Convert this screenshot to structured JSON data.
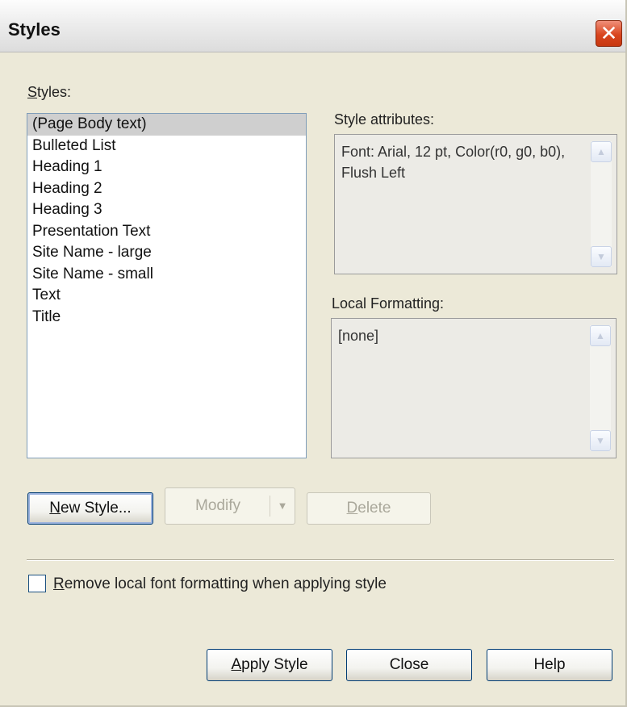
{
  "window": {
    "title": "Styles",
    "close_glyph": "✕"
  },
  "styles_list": {
    "label": "Styles:",
    "items": [
      "(Page Body text)",
      "Bulleted List",
      "Heading 1",
      "Heading 2",
      "Heading 3",
      "Presentation Text",
      "Site Name - large",
      "Site Name - small",
      "Text",
      "Title"
    ],
    "selected_index": 0
  },
  "style_attributes": {
    "label": "Style attributes:",
    "text": "Font: Arial, 12 pt, Color(r0, g0, b0), Flush Left"
  },
  "local_formatting": {
    "label": "Local Formatting:",
    "text": "[none]"
  },
  "buttons": {
    "new_style": "New Style...",
    "modify": "Modify",
    "delete": "Delete",
    "apply_style": "Apply Style",
    "close": "Close",
    "help": "Help"
  },
  "remove_formatting": {
    "label": "Remove local font formatting when applying style",
    "checked": false
  },
  "scroll_glyphs": {
    "up": "▲",
    "down": "▼",
    "dropdown": "▼"
  },
  "colors": {
    "dialog_bg": "#ece9d8",
    "close_button": "#d9461f",
    "selection": "#cfcfcf",
    "list_border": "#7f9db9"
  }
}
